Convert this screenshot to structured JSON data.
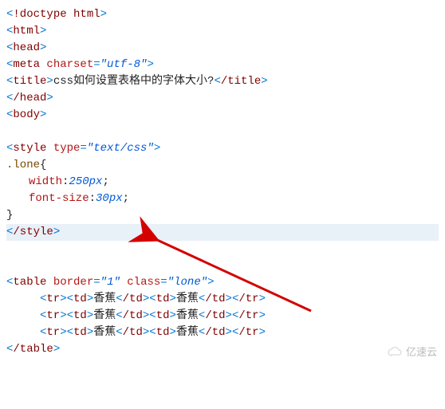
{
  "code": {
    "doctype": "!doctype html",
    "html_open": "html",
    "head_open": "head",
    "meta_tag": "meta",
    "meta_attr": "charset",
    "meta_val": "utf-8",
    "title_tag": "title",
    "title_text": "css如何设置表格中的字体大小?",
    "head_close": "/head",
    "body_open": "body",
    "style_tag": "style",
    "style_attr": "type",
    "style_val": "text/css",
    "selector": ".lone",
    "brace_open": "{",
    "prop1": "width",
    "val1": "250px",
    "prop2": "font-size",
    "val2": "30px",
    "brace_close": "}",
    "style_close": "/style",
    "table_tag": "table",
    "border_attr": "border",
    "border_val": "1",
    "class_attr": "class",
    "class_val": "lone",
    "tr": "tr",
    "td": "td",
    "tr_close": "/tr",
    "td_close": "/td",
    "cell": "香蕉",
    "table_close": "/table"
  },
  "watermark": "亿速云"
}
